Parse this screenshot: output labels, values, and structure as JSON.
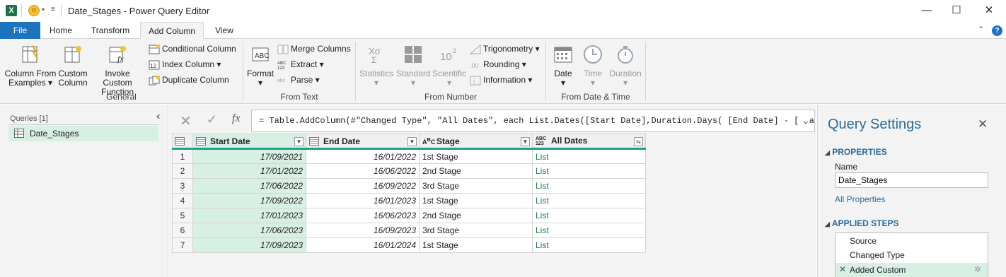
{
  "titlebar": {
    "app_icon": "excel-icon",
    "title": "Date_Stages - Power Query Editor",
    "minimize": "—",
    "maximize": "☐",
    "close": "✕"
  },
  "tabs": {
    "file": "File",
    "home": "Home",
    "transform": "Transform",
    "add_column": "Add Column",
    "view": "View"
  },
  "ribbon": {
    "general": {
      "col_from_examples_1": "Column From",
      "col_from_examples_2": "Examples ▾",
      "custom_column_1": "Custom",
      "custom_column_2": "Column",
      "invoke_function_1": "Invoke Custom",
      "invoke_function_2": "Function",
      "conditional_column": "Conditional Column",
      "index_column": "Index Column ▾",
      "duplicate_column": "Duplicate Column",
      "label": "General"
    },
    "from_text": {
      "format": "Format",
      "merge_columns": "Merge Columns",
      "extract": "Extract ▾",
      "parse": "Parse ▾",
      "label": "From Text"
    },
    "from_number": {
      "statistics": "Statistics",
      "standard": "Standard",
      "scientific": "Scientific",
      "trigonometry": "Trigonometry ▾",
      "rounding": "Rounding ▾",
      "information": "Information ▾",
      "label": "From Number"
    },
    "from_date_time": {
      "date": "Date",
      "time": "Time",
      "duration": "Duration",
      "label": "From Date & Time"
    }
  },
  "queries": {
    "header": "Queries [1]",
    "items": [
      "Date_Stages"
    ]
  },
  "formula": {
    "prefix": "=",
    "text": "Table.AddColumn(#\"Changed Type\", \"All Dates\", each List.Dates([Start Date],Duration.Days( [End Date] - [Start"
  },
  "grid": {
    "columns": [
      {
        "name": "Start Date",
        "type_icon": "calendar-icon"
      },
      {
        "name": "End Date",
        "type_icon": "calendar-icon"
      },
      {
        "name": "Stage",
        "type_icon": "text-type-icon"
      },
      {
        "name": "All Dates",
        "type_icon": "any-type-icon"
      }
    ],
    "rows": [
      {
        "n": "1",
        "start": "17/09/2021",
        "end": "16/01/2022",
        "stage": "1st Stage",
        "all": "List"
      },
      {
        "n": "2",
        "start": "17/01/2022",
        "end": "16/06/2022",
        "stage": "2nd Stage",
        "all": "List"
      },
      {
        "n": "3",
        "start": "17/06/2022",
        "end": "16/09/2022",
        "stage": "3rd Stage",
        "all": "List"
      },
      {
        "n": "4",
        "start": "17/09/2022",
        "end": "16/01/2023",
        "stage": "1st Stage",
        "all": "List"
      },
      {
        "n": "5",
        "start": "17/01/2023",
        "end": "16/06/2023",
        "stage": "2nd Stage",
        "all": "List"
      },
      {
        "n": "6",
        "start": "17/06/2023",
        "end": "16/09/2023",
        "stage": "3rd Stage",
        "all": "List"
      },
      {
        "n": "7",
        "start": "17/09/2023",
        "end": "16/01/2024",
        "stage": "1st Stage",
        "all": "List"
      }
    ]
  },
  "settings": {
    "title": "Query Settings",
    "properties": "PROPERTIES",
    "name_label": "Name",
    "name_value": "Date_Stages",
    "all_properties": "All Properties",
    "applied_steps": "APPLIED STEPS",
    "steps": [
      "Source",
      "Changed Type",
      "Added Custom"
    ]
  },
  "colors": {
    "accent": "#1e73be",
    "selected_column": "#d8efe3",
    "header_underline": "#1aa589"
  }
}
